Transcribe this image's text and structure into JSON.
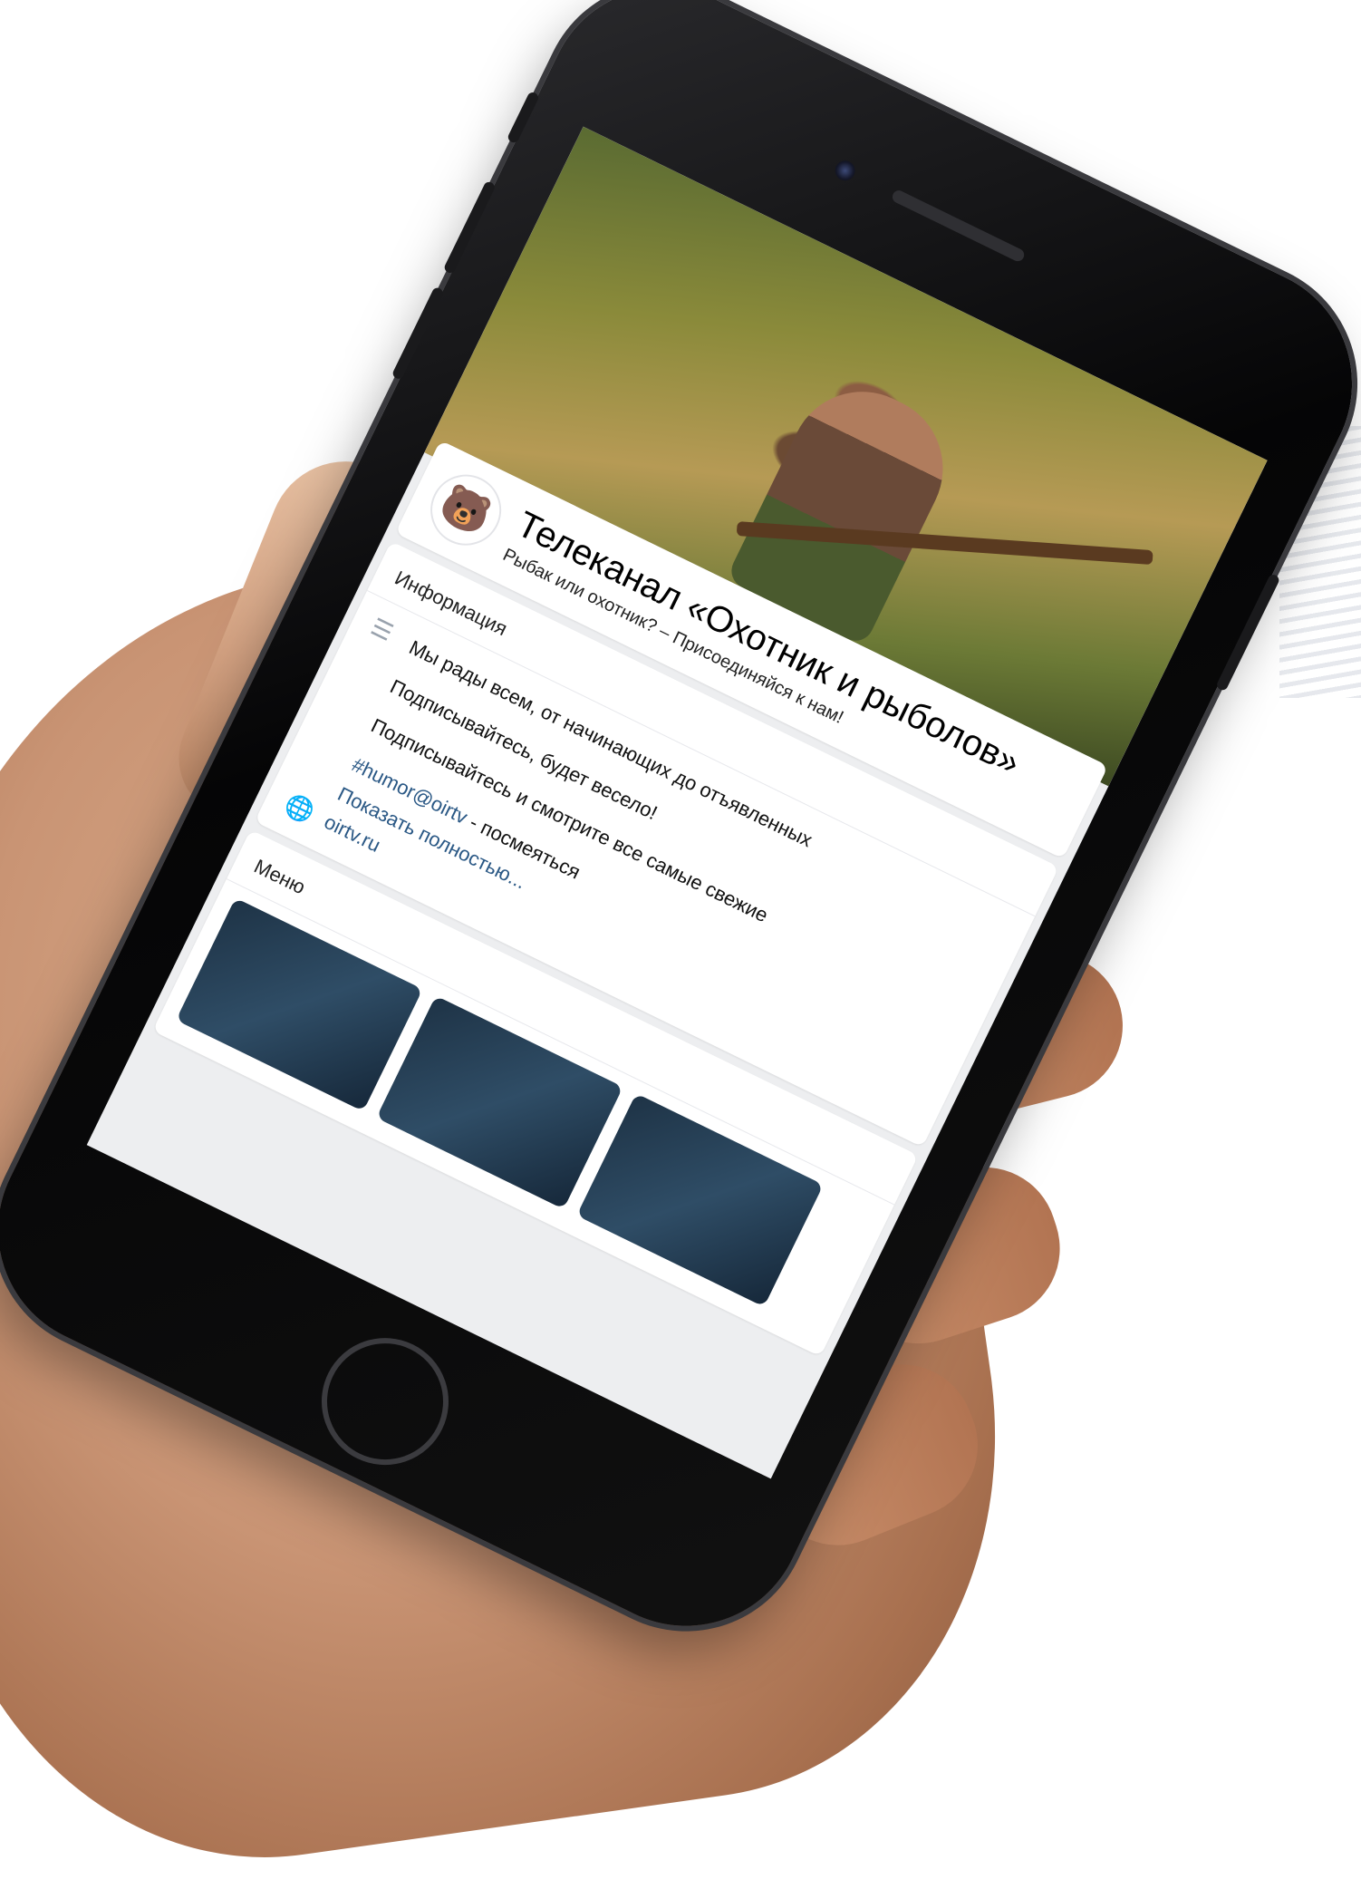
{
  "group": {
    "title": "Телеканал «Охотник и рыболов»",
    "subtitle": "Рыбак или охотник? – Присоединяйся к нам!"
  },
  "info": {
    "section_label": "Информация",
    "text_line_1": "Мы рады всем, от начинающих до отъявленных",
    "text_line_2": "Подписывайтесь, будет весело!",
    "text_line_3": "Подписывайтесь и смотрите все самые свежие",
    "hashtag": "#humor@oirtv",
    "hashtag_suffix": " - посмеяться",
    "show_more": "Показать полностью...",
    "website": "oirtv.ru"
  },
  "menu": {
    "section_label": "Меню"
  },
  "icons": {
    "avatar": "bear-head-logo",
    "info": "text-lines-icon",
    "website": "globe-icon"
  },
  "colors": {
    "link": "#2a5885",
    "phone_body": "#0b0b0d"
  }
}
